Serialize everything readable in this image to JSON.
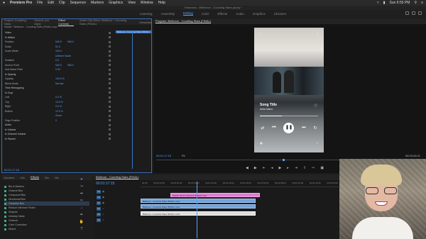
{
  "menubar": {
    "apple": "",
    "app": "Premiere Pro",
    "items": [
      "File",
      "Edit",
      "Clip",
      "Sequence",
      "Markers",
      "Graphics",
      "View",
      "Window",
      "Help"
    ],
    "clock": "Sun 6:55 PM"
  },
  "titlebar": "/Volumes/.../Bellevue - Counting Stars.prproj *",
  "workspaces": [
    "Learning",
    "Assembly",
    "Editing",
    "Color",
    "Effects",
    "Audio",
    "Graphics",
    "Libraries"
  ],
  "active_workspace": "Editing",
  "effect_controls": {
    "tabs": [
      "Project: Counting Stars",
      "Source: (no clips)",
      "Effect Controls",
      "Audio Clip Mixer: Bellevue - Counting Stars (FINAL)",
      "Metadata"
    ],
    "active_tab": "Effect Controls",
    "header": "Master * Bellevue - Counting Stars (FINAL).mp4",
    "clip_label": "Bellevue - Counting Stars (FINAL)",
    "rows": [
      {
        "label": "Video",
        "v1": "",
        "v2": "",
        "h": true
      },
      {
        "label": "fx Motion",
        "v1": "",
        "v2": "",
        "h": true
      },
      {
        "label": "Position",
        "v1": "540.0",
        "v2": "960.0"
      },
      {
        "label": "Scale",
        "v1": "51.0",
        "v2": ""
      },
      {
        "label": "Scale Width",
        "v1": "100.0",
        "v2": ""
      },
      {
        "label": "",
        "v1": "Uniform Scale",
        "v2": ""
      },
      {
        "label": "Rotation",
        "v1": "0.0",
        "v2": ""
      },
      {
        "label": "Anchor Point",
        "v1": "540.0",
        "v2": "960.0"
      },
      {
        "label": "Anti-flicker Filter",
        "v1": "0.00",
        "v2": ""
      },
      {
        "label": "fx Opacity",
        "v1": "",
        "v2": "",
        "h": true
      },
      {
        "label": "Opacity",
        "v1": "100.0 %",
        "v2": ""
      },
      {
        "label": "Blend Mode",
        "v1": "Normal",
        "v2": ""
      },
      {
        "label": "Time Remapping",
        "v1": "",
        "v2": "",
        "h": true
      },
      {
        "label": "fx Crop",
        "v1": "",
        "v2": "",
        "h": true
      },
      {
        "label": "Left",
        "v1": "0.0 %",
        "v2": ""
      },
      {
        "label": "Top",
        "v1": "13.0 %",
        "v2": ""
      },
      {
        "label": "Right",
        "v1": "0.0 %",
        "v2": ""
      },
      {
        "label": "Bottom",
        "v1": "12.0 %",
        "v2": ""
      },
      {
        "label": "",
        "v1": "Zoom",
        "v2": ""
      },
      {
        "label": "Edge Feather",
        "v1": "0",
        "v2": ""
      },
      {
        "label": "Audio",
        "v1": "",
        "v2": "",
        "h": true
      },
      {
        "label": "fx Volume",
        "v1": "",
        "v2": "",
        "h": true
      },
      {
        "label": "fx Channel Volume",
        "v1": "",
        "v2": "",
        "h": true
      },
      {
        "label": "fx Panner",
        "v1": "",
        "v2": "",
        "h": true
      }
    ],
    "timecode": "00:01:17:15"
  },
  "program": {
    "tab": "Program: Bellevue - Counting Stars (FINAL)",
    "song_title": "Song Title",
    "song_artist": "Artist Name",
    "progress": 0.38,
    "timecode": "00:01:17:15",
    "fit": "Fit",
    "duration": "00:03:43:21"
  },
  "project": {
    "tabs": [
      "Libraries",
      "Info",
      "Effects",
      "Ma",
      "His"
    ],
    "items": [
      "Bin & Markers",
      "Channel Blur",
      "Compound Blur",
      "Directional Blur",
      "Gaussian Blur",
      "Reduce Interlace Flicker",
      "Sharpen",
      "Unsharp Mask",
      "Channel",
      "Color Correction",
      "Distort"
    ],
    "selected": 4
  },
  "timeline": {
    "tab": "Bellevue - Counting Stars (FINAL)",
    "timecode": "00:01:17:15",
    "ruler": [
      "00:00",
      "00:00:16:00",
      "00:00:32:00",
      "00:00:48:00",
      "00:01:04:00",
      "00:01:20:00",
      "00:01:36:00",
      "00:01:52:00",
      "00:02:08:00",
      "00:02:24:00",
      "00:02:40:00",
      "00:02:56:00"
    ],
    "tracks": [
      "V3",
      "V2",
      "V1",
      "A1",
      "A2",
      "A3"
    ],
    "clips": {
      "pink": "Spotify Screen Record (Edited).mp4",
      "blue1": "Bellevue - Counting Stars (FINAL).mp4",
      "blue2": "Bellevue - Counting Stars (FINAL).mp4",
      "white": "Bellevue - Counting Stars (FINAL).mp3"
    }
  }
}
